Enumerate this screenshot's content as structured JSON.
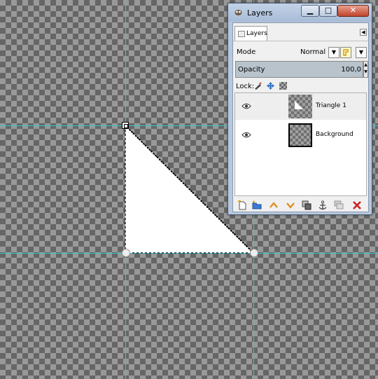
{
  "canvas": {
    "guide_color": "#30c8c8"
  },
  "dialog": {
    "title": "Layers",
    "controls": {
      "minimize": "▁",
      "maximize": "□",
      "close": "✕"
    },
    "tab_label": "Layers",
    "mode_label": "Mode",
    "mode_value": "Normal",
    "opacity_label": "Opacity",
    "opacity_value": "100,0",
    "lock_label": "Lock:",
    "layers": [
      {
        "name": "Triangle 1",
        "visible": true,
        "selected": true
      },
      {
        "name": "Background",
        "visible": true,
        "selected": false
      }
    ],
    "bottom_toolbar": [
      "new-layer-icon",
      "new-layer-group-icon",
      "raise-layer-icon",
      "lower-layer-icon",
      "duplicate-layer-icon",
      "anchor-layer-icon",
      "merge-layer-icon",
      "delete-layer-icon"
    ],
    "colors": {
      "raise": "#e08a1e",
      "lower": "#e08a1e",
      "delete": "#cc2222",
      "folder": "#3a7bd5"
    }
  }
}
